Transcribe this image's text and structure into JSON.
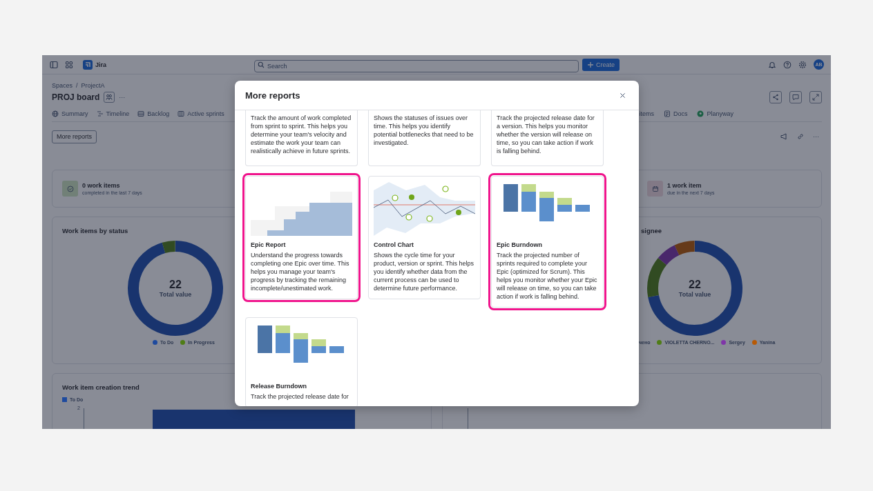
{
  "app": {
    "product": "Jira",
    "search": {
      "placeholder": "Search"
    },
    "create_button": "Create",
    "avatar": "AB"
  },
  "breadcrumbs": {
    "items": [
      "Spaces",
      "ProjectA"
    ],
    "separator": "/"
  },
  "board_title": "PROJ board",
  "more_menu": "···",
  "tabs_left": [
    {
      "label": "Summary"
    },
    {
      "label": "Timeline"
    },
    {
      "label": "Backlog"
    },
    {
      "label": "Active sprints"
    }
  ],
  "tabs_right": [
    {
      "label": "items"
    },
    {
      "label": "Docs"
    },
    {
      "label": "Planyway"
    }
  ],
  "more_reports_button": "More reports",
  "toolbar_more": "···",
  "stats": [
    {
      "title": "0 work items",
      "subtitle": "completed in the last 7 days"
    },
    {
      "title": "1 work item",
      "subtitle": "due in the next 7 days"
    }
  ],
  "status_panel": {
    "title": "Work items by status",
    "total": "22",
    "total_label": "Total value",
    "legend": [
      {
        "label": "To Do",
        "color": "#1e4a9e"
      },
      {
        "label": "In Progress",
        "color": "#4f7d16"
      }
    ]
  },
  "assignee_panel": {
    "title": "signee",
    "total": "22",
    "total_label": "Total value",
    "legend": [
      {
        "label": "чено"
      },
      {
        "label": "VIOLETTA CHERNO...",
        "color": "#4f7d16"
      },
      {
        "label": "Sergey",
        "color": "#7f35a8"
      },
      {
        "label": "Yanina",
        "color": "#b85a05"
      }
    ]
  },
  "trend_panel": {
    "title": "Work item creation trend",
    "legend": [
      {
        "label": "To Do",
        "color": "#1e4a9e"
      }
    ],
    "y_tick": "2"
  },
  "modal": {
    "title": "More reports",
    "reports": [
      {
        "description": "Track the amount of work completed from sprint to sprint. This helps you determine your team's velocity and estimate the work your team can realistically achieve in future sprints.",
        "highlighted": false
      },
      {
        "description": "Shows the statuses of issues over time. This helps you identify potential bottlenecks that need to be investigated.",
        "highlighted": false
      },
      {
        "description": "Track the projected release date for a version. This helps you monitor whether the version will release on time, so you can take action if work is falling behind.",
        "highlighted": false
      },
      {
        "kind": "epic",
        "title": "Epic Report",
        "description": "Understand the progress towards completing one Epic over time. This helps you manage your team's progress by tracking the remaining incomplete/unestimated work.",
        "highlighted": true
      },
      {
        "kind": "control",
        "title": "Control Chart",
        "description": "Shows the cycle time for your product, version or sprint. This helps you identify whether data from the current process can be used to determine future performance.",
        "highlighted": false
      },
      {
        "kind": "burndown",
        "title": "Epic Burndown",
        "description": "Track the projected number of sprints required to complete your Epic (optimized for Scrum). This helps you monitor whether your Epic will release on time, so you can take action if work is falling behind.",
        "highlighted": true
      },
      {
        "kind": "burndown",
        "title": "Release Burndown",
        "description": "Track the projected release date for",
        "highlighted": false
      }
    ]
  }
}
